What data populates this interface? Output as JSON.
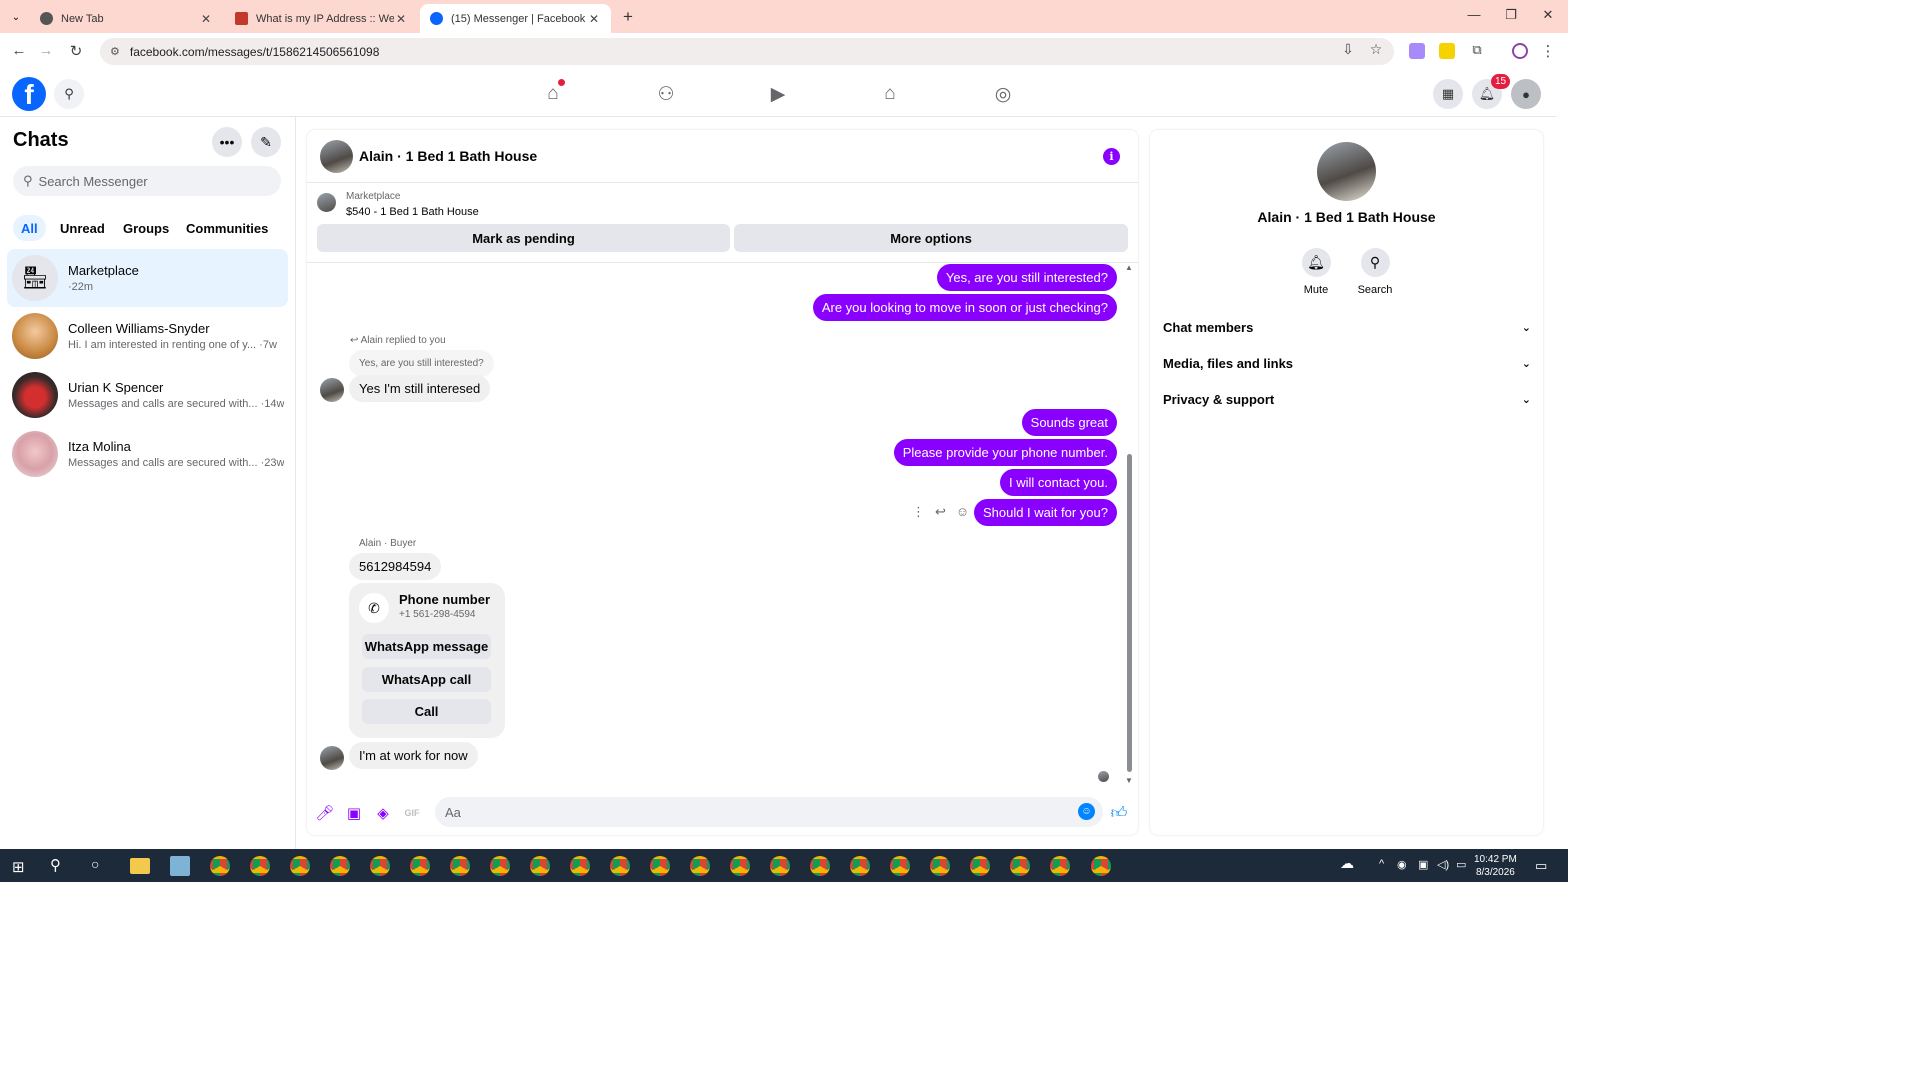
{
  "browser": {
    "tabs": [
      {
        "label": "New Tab",
        "active": false
      },
      {
        "label": "What is my IP Address :: WebBrowserTools",
        "active": false
      },
      {
        "label": "(15) Messenger | Facebook",
        "active": true
      }
    ],
    "new_tab_label": "+",
    "url": "facebook.com/messages/t/1586214506561098",
    "window_controls": {
      "minimize": "—",
      "maximize": "❐",
      "close": "✕"
    }
  },
  "fb_header": {
    "notification_count": "15",
    "nav_icons": [
      "home-icon",
      "friends-icon",
      "video-icon",
      "marketplace-icon",
      "groups-icon"
    ]
  },
  "sidebar": {
    "title": "Chats",
    "search_placeholder": "Search Messenger",
    "filters": [
      "All",
      "Unread",
      "Groups",
      "Communities"
    ],
    "active_filter": "All",
    "chats": [
      {
        "name": "Marketplace",
        "snippet": "·22m",
        "active": true
      },
      {
        "name": "Colleen Williams-Snyder",
        "snippet": "Hi. I am interested in renting one of y... ·7w",
        "active": false
      },
      {
        "name": "Urian K Spencer",
        "snippet": "Messages and calls are secured with... ·14w",
        "active": false
      },
      {
        "name": "Itza Molina",
        "snippet": "Messages and calls are secured with... ·23w",
        "active": false
      }
    ]
  },
  "conversation": {
    "title": "Alain · 1 Bed 1 Bath House",
    "marketplace_label": "Marketplace",
    "listing": "$540 - 1 Bed 1 Bath House",
    "mark_pending": "Mark as pending",
    "more_options": "More options",
    "messages": {
      "out1": "Yes, are you still interested?",
      "out2": "Are you looking to move in soon or just checking?",
      "reply_meta": "Alain replied to you",
      "quoted": "Yes, are you still interested?",
      "in1": "Yes I'm still interesed",
      "out3": "Sounds great",
      "out4": "Please provide your phone number.",
      "out5": "I will contact you.",
      "out6": "Should I wait for you?",
      "sender_meta": "Alain · Buyer",
      "in2": "5612984594",
      "in3": "I'm at work for now"
    },
    "phone_card": {
      "title": "Phone number",
      "number": "+1 561-298-4594",
      "buttons": [
        "WhatsApp message",
        "WhatsApp call",
        "Call"
      ]
    },
    "composer_placeholder": "Aa"
  },
  "details_panel": {
    "name": "Alain · 1 Bed 1 Bath House",
    "actions": [
      "Mute",
      "Search"
    ],
    "sections": [
      "Chat members",
      "Media, files and links",
      "Privacy & support"
    ]
  },
  "taskbar": {
    "time": "10:42 PM",
    "date": "8/3/2026"
  },
  "colors": {
    "accent_purple": "#8a00ff",
    "fb_blue": "#0866ff",
    "tabbar_pink": "#fdd8d0"
  }
}
